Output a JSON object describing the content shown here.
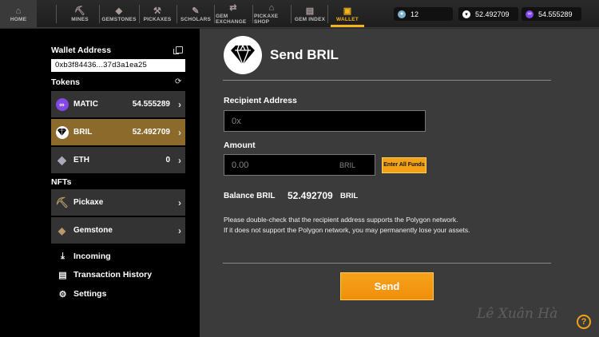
{
  "nav": {
    "items": [
      {
        "label": "HOME",
        "icon": "home-icon"
      },
      {
        "label": "MINES",
        "icon": "mine-cart-icon"
      },
      {
        "label": "GEMSTONES",
        "icon": "gem-icon"
      },
      {
        "label": "PICKAXES",
        "icon": "pickaxe-icon"
      },
      {
        "label": "SCHOLARS",
        "icon": "scholar-icon"
      },
      {
        "label": "GEM EXCHANGE",
        "icon": "exchange-icon"
      },
      {
        "label": "PICKAXE SHOP",
        "icon": "shop-icon"
      },
      {
        "label": "GEM INDEX",
        "icon": "index-icon"
      },
      {
        "label": "WALLET",
        "icon": "wallet-icon"
      }
    ],
    "active": "WALLET",
    "accent": "#f3b41b",
    "stat_gems": "12",
    "stat_bril": "52.492709",
    "stat_matic": "54.555289"
  },
  "sidebar": {
    "wallet_label": "Wallet Address",
    "wallet_address": "0xb3f84436...37d3a1ea25",
    "tokens_label": "Tokens",
    "tokens": [
      {
        "name": "MATIC",
        "value": "54.555289",
        "icon": "matic-icon"
      },
      {
        "name": "BRIL",
        "value": "52.492709",
        "icon": "bril-icon",
        "selected": true
      },
      {
        "name": "ETH",
        "value": "0",
        "icon": "eth-icon"
      }
    ],
    "nfts_label": "NFTs",
    "nfts": [
      {
        "name": "Pickaxe",
        "icon": "pickaxe-icon"
      },
      {
        "name": "Gemstone",
        "icon": "gemstone-icon"
      }
    ],
    "menu": [
      {
        "label": "Incoming",
        "icon": "download-icon"
      },
      {
        "label": "Transaction History",
        "icon": "history-icon"
      },
      {
        "label": "Settings",
        "icon": "gear-icon"
      }
    ]
  },
  "send": {
    "title": "Send BRIL",
    "recipient_label": "Recipient Address",
    "recipient_placeholder": "0x",
    "amount_label": "Amount",
    "amount_placeholder": "0.00",
    "amount_unit": "BRIL",
    "enter_all_label": "Enter All Funds",
    "balance_label": "Balance BRIL",
    "balance_value": "52.492709",
    "balance_unit": "BRIL",
    "warning_line1": "Please double-check that the recipient address supports the Polygon network.",
    "warning_line2": "If it does not support the Polygon network, you may permanently lose your assets.",
    "send_label": "Send",
    "help_label": "?",
    "button_color": "#f3a116"
  },
  "watermark": "Lê Xuân Hà"
}
